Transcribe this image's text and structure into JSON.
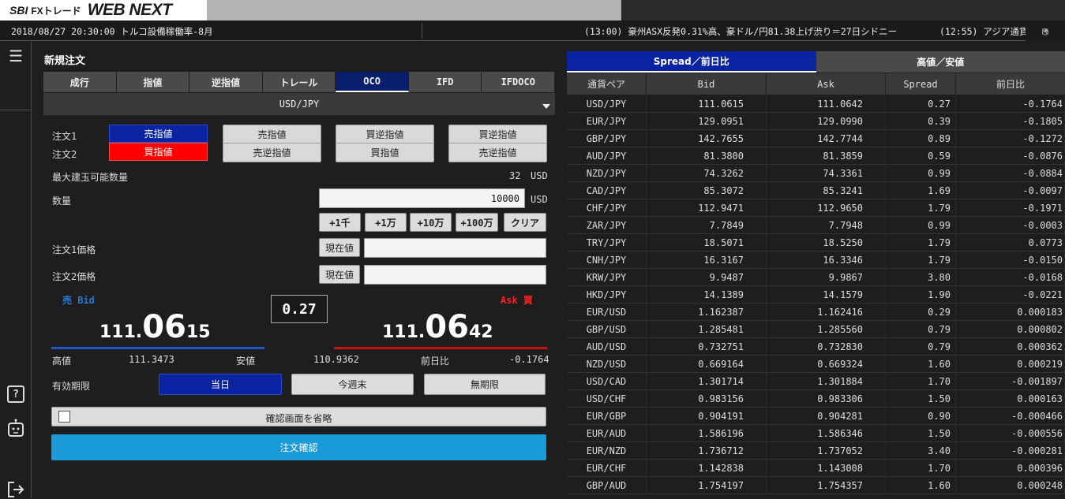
{
  "app": {
    "logo_sbi": "SBI",
    "logo_fx": "FXトレード",
    "logo_webnext": "WEB NEXT"
  },
  "news": {
    "left": "2018/08/27 20:30:00 トルコ設備稼働率-8月",
    "right1": "(13:00) 豪州ASX反発0.31%高、豪ドル/円81.38上げ渋り＝27日シドニー",
    "right2": "(12:55) アジア通貨"
  },
  "rail": {
    "menu_icon": "menu-icon",
    "help_icon": "help-icon",
    "bot_icon": "bot-icon",
    "logout_icon": "logout-icon"
  },
  "order": {
    "title": "新規注文",
    "tabs": [
      "成行",
      "指値",
      "逆指値",
      "トレール",
      "OCO",
      "IFD",
      "IFDOCO"
    ],
    "active_tab": "OCO",
    "pair": "USD/JPY",
    "order1_label": "注文1",
    "order2_label": "注文2",
    "combos": [
      {
        "top": "売指値",
        "bottom": "買指値"
      },
      {
        "top": "売指値",
        "bottom": "売逆指値"
      },
      {
        "top": "買逆指値",
        "bottom": "買指値"
      },
      {
        "top": "買逆指値",
        "bottom": "売逆指値"
      }
    ],
    "max_label": "最大建玉可能数量",
    "max_value": "32",
    "max_unit": "USD",
    "qty_label": "数量",
    "qty_value": "10000",
    "qty_unit": "USD",
    "qty_buttons": [
      "+1千",
      "+1万",
      "+10万",
      "+100万",
      "クリア"
    ],
    "price1_label": "注文1価格",
    "price2_label": "注文2価格",
    "current_btn": "現在値",
    "bid_label": "売 Bid",
    "ask_label": "Ask 買",
    "bid": {
      "a": "111.",
      "b": "06",
      "c": "15"
    },
    "ask": {
      "a": "111.",
      "b": "06",
      "c": "42"
    },
    "spread": "0.27",
    "high_label": "高値",
    "high_value": "111.3473",
    "low_label": "安値",
    "low_value": "110.9362",
    "change_label": "前日比",
    "change_value": "-0.1764",
    "validity_label": "有効期限",
    "validity_options": [
      "当日",
      "今週末",
      "無期限"
    ],
    "skip_confirm": "確認画面を省略",
    "confirm_btn": "注文確認"
  },
  "rates": {
    "tabs": [
      "Spread／前日比",
      "高値／安値"
    ],
    "headers": [
      "通貨ペア",
      "Bid",
      "Ask",
      "Spread",
      "前日比"
    ],
    "rows": [
      [
        "USD/JPY",
        "111.0615",
        "111.0642",
        "0.27",
        "-0.1764"
      ],
      [
        "EUR/JPY",
        "129.0951",
        "129.0990",
        "0.39",
        "-0.1805"
      ],
      [
        "GBP/JPY",
        "142.7655",
        "142.7744",
        "0.89",
        "-0.1272"
      ],
      [
        "AUD/JPY",
        "81.3800",
        "81.3859",
        "0.59",
        "-0.0876"
      ],
      [
        "NZD/JPY",
        "74.3262",
        "74.3361",
        "0.99",
        "-0.0884"
      ],
      [
        "CAD/JPY",
        "85.3072",
        "85.3241",
        "1.69",
        "-0.0097"
      ],
      [
        "CHF/JPY",
        "112.9471",
        "112.9650",
        "1.79",
        "-0.1971"
      ],
      [
        "ZAR/JPY",
        "7.7849",
        "7.7948",
        "0.99",
        "-0.0003"
      ],
      [
        "TRY/JPY",
        "18.5071",
        "18.5250",
        "1.79",
        "0.0773"
      ],
      [
        "CNH/JPY",
        "16.3167",
        "16.3346",
        "1.79",
        "-0.0150"
      ],
      [
        "KRW/JPY",
        "9.9487",
        "9.9867",
        "3.80",
        "-0.0168"
      ],
      [
        "HKD/JPY",
        "14.1389",
        "14.1579",
        "1.90",
        "-0.0221"
      ],
      [
        "EUR/USD",
        "1.162387",
        "1.162416",
        "0.29",
        "0.000183"
      ],
      [
        "GBP/USD",
        "1.285481",
        "1.285560",
        "0.79",
        "0.000802"
      ],
      [
        "AUD/USD",
        "0.732751",
        "0.732830",
        "0.79",
        "0.000362"
      ],
      [
        "NZD/USD",
        "0.669164",
        "0.669324",
        "1.60",
        "0.000219"
      ],
      [
        "USD/CAD",
        "1.301714",
        "1.301884",
        "1.70",
        "-0.001897"
      ],
      [
        "USD/CHF",
        "0.983156",
        "0.983306",
        "1.50",
        "0.000163"
      ],
      [
        "EUR/GBP",
        "0.904191",
        "0.904281",
        "0.90",
        "-0.000466"
      ],
      [
        "EUR/AUD",
        "1.586196",
        "1.586346",
        "1.50",
        "-0.000556"
      ],
      [
        "EUR/NZD",
        "1.736712",
        "1.737052",
        "3.40",
        "-0.000281"
      ],
      [
        "EUR/CHF",
        "1.142838",
        "1.143008",
        "1.70",
        "0.000396"
      ],
      [
        "GBP/AUD",
        "1.754197",
        "1.754357",
        "1.60",
        "0.000248"
      ]
    ]
  },
  "colors": {
    "accent_blue": "#0a23a0",
    "sell_red": "#ff0000",
    "confirm_blue": "#1a9ad8"
  }
}
